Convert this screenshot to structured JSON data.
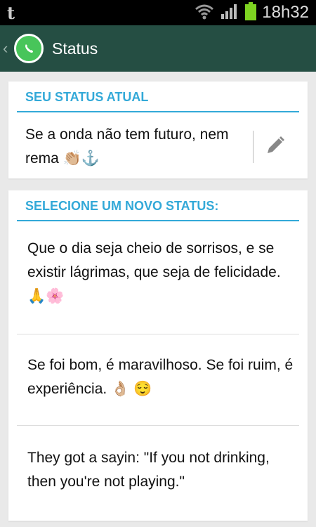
{
  "statusbar": {
    "app_letter": "t",
    "time": "18h32"
  },
  "actionbar": {
    "title": "Status",
    "logo_icon": "whatsapp-icon"
  },
  "current_status": {
    "header": "SEU STATUS ATUAL",
    "text": "Se a onda não tem futuro, nem rema",
    "emojis": [
      "👏🏼",
      "⚓"
    ]
  },
  "new_status": {
    "header": "SELECIONE UM NOVO STATUS:",
    "options": [
      {
        "text": "Que o dia seja cheio de sorrisos, e se existir lágrimas, que seja de felicidade.",
        "emojis": [
          "🙏",
          "🌸"
        ]
      },
      {
        "text": "Se foi bom, é maravilhoso. Se foi ruim, é experiência.",
        "emojis": [
          "👌🏼",
          "😌"
        ]
      },
      {
        "text": "They got a sayin: \"If you not drinking, then you're not playing.\"",
        "emojis": []
      }
    ]
  },
  "colors": {
    "accent": "#33a9d8",
    "actionbar": "#254e43",
    "whatsapp_green": "#48c55a"
  }
}
